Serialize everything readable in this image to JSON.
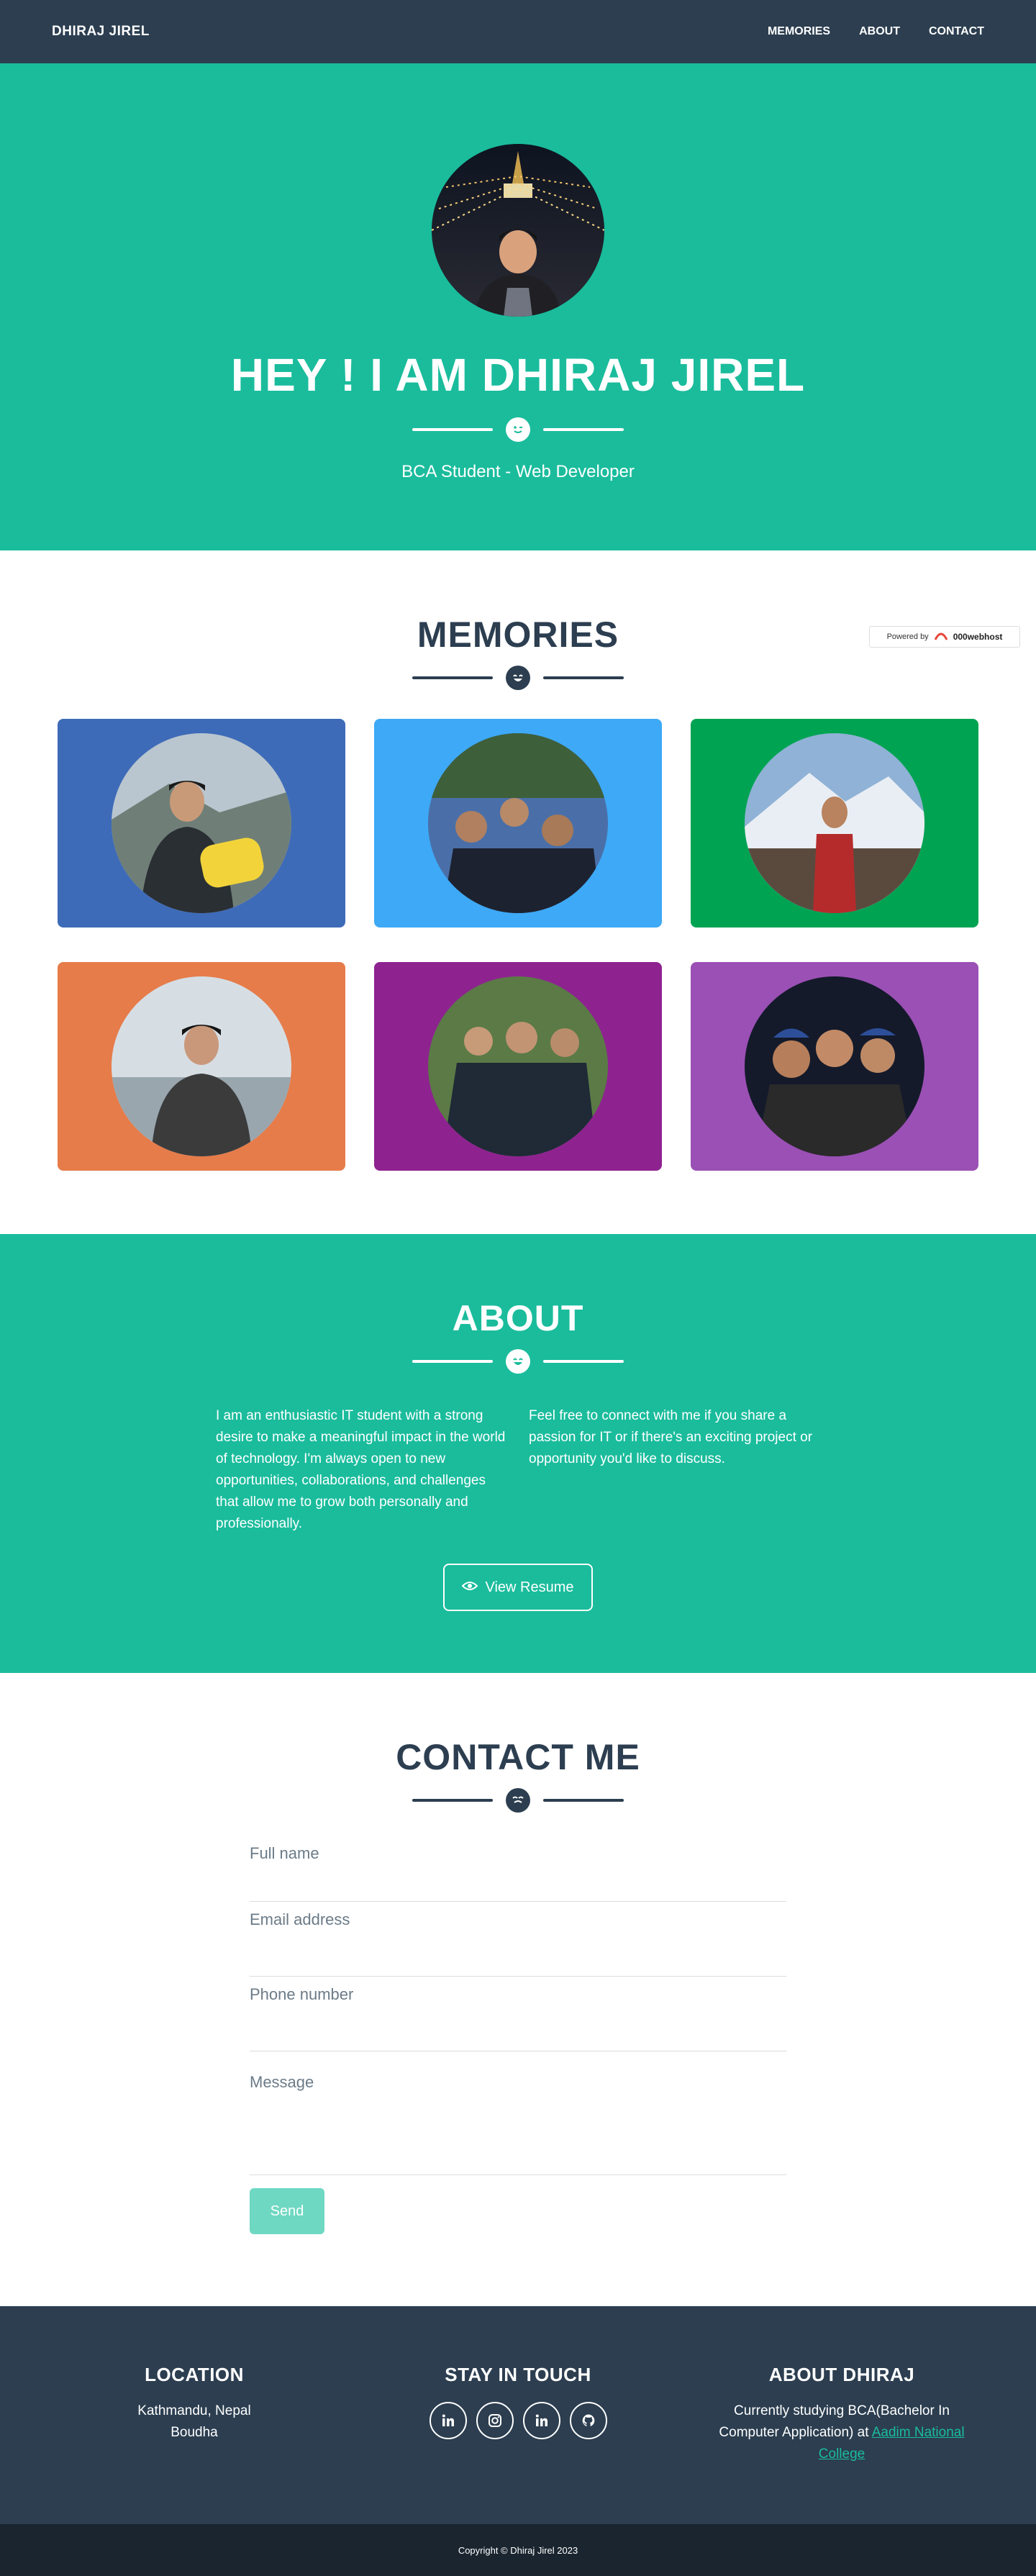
{
  "nav": {
    "brand": "DHIRAJ JIREL",
    "links": [
      "MEMORIES",
      "ABOUT",
      "CONTACT"
    ]
  },
  "hero": {
    "title": "HEY ! I AM DHIRAJ JIREL",
    "subtitle": "BCA Student - Web Developer"
  },
  "memories": {
    "title": "MEMORIES",
    "powered_by": "Powered by",
    "powered_brand": "000webhost",
    "card_colors": [
      "#3e6bb8",
      "#3ea9f6",
      "#00a352",
      "#e67c4a",
      "#8e2390",
      "#9b50b5"
    ]
  },
  "about": {
    "title": "ABOUT",
    "left": "I am an enthusiastic IT student with a strong desire to make a meaningful impact in the world of technology. I'm always open to new opportunities, collaborations, and challenges that allow me to grow both personally and professionally.",
    "right": "Feel free to connect with me if you share a passion for IT or if there's an exciting project or opportunity you'd like to discuss.",
    "resume_label": "View Resume"
  },
  "contact": {
    "title": "CONTACT ME",
    "name_placeholder": "Full name",
    "email_placeholder": "Email address",
    "phone_placeholder": "Phone number",
    "message_placeholder": "Message",
    "send_label": "Send"
  },
  "footer": {
    "location_title": "LOCATION",
    "location_line1": "Kathmandu, Nepal",
    "location_line2": "Boudha",
    "social_title": "STAY IN TOUCH",
    "about_title": "ABOUT DHIRAJ",
    "about_text": "Currently studying BCA(Bachelor In Computer Application) at ",
    "about_link": "Aadim National College",
    "copyright": "Copyright © Dhiraj Jirel 2023"
  },
  "colors": {
    "primary": "#1abc9c",
    "dark": "#2c3e50",
    "darker": "#1a252f"
  }
}
